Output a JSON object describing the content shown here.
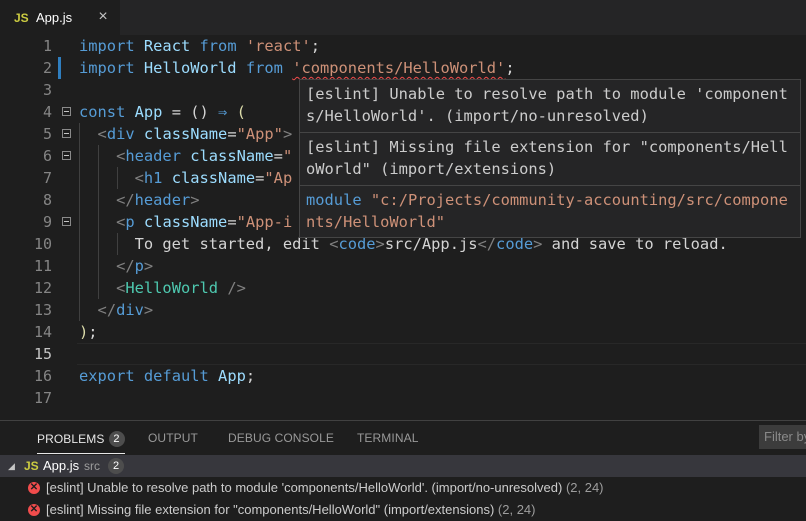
{
  "tab": {
    "icon": "JS",
    "name": "App.js",
    "close": "×"
  },
  "editor": {
    "line_numbers": [
      "1",
      "2",
      "3",
      "4",
      "5",
      "6",
      "7",
      "8",
      "9",
      "10",
      "11",
      "12",
      "13",
      "14",
      "15",
      "16",
      "17"
    ],
    "hover": {
      "messages": [
        "[eslint] Unable to resolve path to module 'components/HelloWorld'. (import/no-unresolved)",
        "[eslint] Missing file extension for \"components/HelloWorld\" (import/extensions)"
      ],
      "module_keyword": "module",
      "module_path": "\"c:/Projects/community-accounting/src/components/HelloWorld\""
    }
  },
  "panel": {
    "tabs": {
      "problems": "PROBLEMS",
      "problems_count": "2",
      "output": "OUTPUT",
      "debug": "DEBUG CONSOLE",
      "terminal": "TERMINAL"
    },
    "filter_placeholder": "Filter by",
    "file": {
      "icon": "JS",
      "name": "App.js",
      "dir": "src",
      "count": "2"
    },
    "problems": [
      {
        "text": "[eslint] Unable to resolve path to module 'components/HelloWorld'. (import/no-unresolved)",
        "loc": "(2, 24)"
      },
      {
        "text": "[eslint] Missing file extension for \"components/HelloWorld\" (import/extensions)",
        "loc": "(2, 24)"
      }
    ]
  },
  "colors": {
    "error": "#f14c4c",
    "keyword": "#569cd6",
    "string": "#ce9178",
    "attr": "#9cdcfe",
    "js_icon": "#cbcb41"
  }
}
